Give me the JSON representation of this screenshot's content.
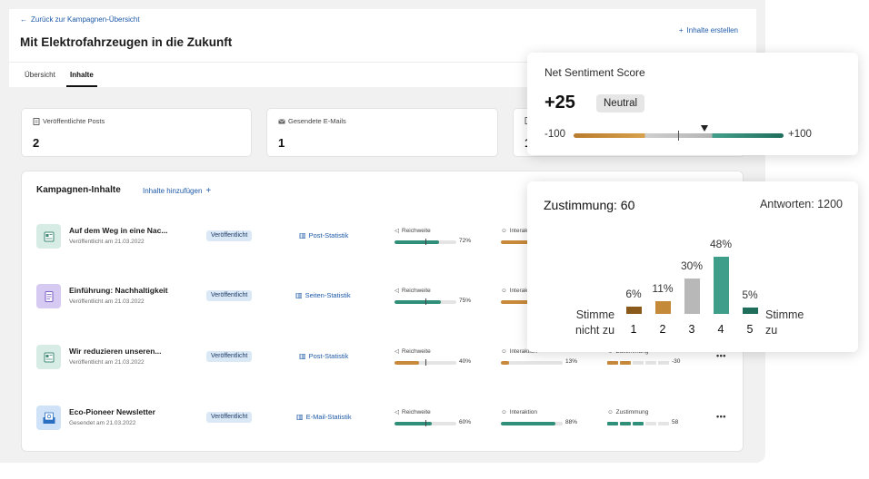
{
  "header": {
    "back_label": "Zurück zur Kampagnen-Übersicht",
    "title": "Mit Elektrofahrzeugen in die Zukunft",
    "create_label": "Inhalte erstellen"
  },
  "tabs": [
    {
      "label": "Übersicht",
      "active": false
    },
    {
      "label": "Inhalte",
      "active": true
    }
  ],
  "stats": [
    {
      "label": "Veröffentlichte Posts",
      "value": "2",
      "icon": "document-icon"
    },
    {
      "label": "Gesendete E-Mails",
      "value": "1",
      "icon": "mail-icon"
    },
    {
      "label": "",
      "value": "1",
      "icon": "document-icon"
    }
  ],
  "content": {
    "title": "Kampagnen-Inhalte",
    "add_label": "Inhalte hinzufügen",
    "rows": [
      {
        "title": "Auf dem Weg in eine Nac...",
        "date": "Veröffentlicht am 21.03.2022",
        "status": "Veröffentlicht",
        "link": "Post-Statistik",
        "icon": "post-icon",
        "icon_bg": "#d7ece5",
        "reach_label": "Reichweite",
        "reach": "72%",
        "reach_value": 0.72,
        "interaction_label": "Interaktion",
        "interaction": ""
      },
      {
        "title": "Einführung: Nachhaltigkeit",
        "date": "Veröffentlicht am 21.03.2022",
        "status": "Veröffentlicht",
        "link": "Seiten-Statistik",
        "icon": "page-icon",
        "icon_bg": "#d6c9f2",
        "reach_label": "Reichweite",
        "reach": "75%",
        "reach_value": 0.75,
        "interaction_label": "Interaktion",
        "interaction": ""
      },
      {
        "title": "Wir reduzieren unseren...",
        "date": "Veröffentlicht am 21.03.2022",
        "status": "Veröffentlicht",
        "link": "Post-Statistik",
        "icon": "post-icon",
        "icon_bg": "#d7ece5",
        "reach_label": "Reichweite",
        "reach": "40%",
        "reach_value": 0.4,
        "interaction_label": "Interaktion",
        "interaction": "13%",
        "interaction_value": 0.13,
        "approval_label": "Zustimmung",
        "approval": "-30",
        "approval_segments": 2
      },
      {
        "title": "Eco-Pioneer Newsletter",
        "date": "Gesendet am 21.03.2022",
        "status": "Veröffentlicht",
        "link": "E-Mail-Statistik",
        "icon": "newsletter-icon",
        "icon_bg": "#cfe2f7",
        "reach_label": "Reichweite",
        "reach": "60%",
        "reach_value": 0.6,
        "interaction_label": "Interaktion",
        "interaction": "88%",
        "interaction_value": 0.88,
        "approval_label": "Zustimmung",
        "approval": "58",
        "approval_segments": 3
      }
    ],
    "more_label": "•••"
  },
  "sentiment": {
    "title": "Net Sentiment Score",
    "value": "+25",
    "badge": "Neutral",
    "min": "-100",
    "max": "+100",
    "score": 25
  },
  "chart_data": {
    "type": "bar",
    "title": "Zustimmung: 60",
    "subtitle": "Antworten: 1200",
    "categories": [
      "1",
      "2",
      "3",
      "4",
      "5"
    ],
    "values": [
      6,
      11,
      30,
      48,
      5
    ],
    "labels": [
      "6%",
      "11%",
      "30%",
      "48%",
      "5%"
    ],
    "colors": [
      "#8a5a1c",
      "#c5893a",
      "#b8b8b8",
      "#3f9e89",
      "#1f6e5c"
    ],
    "left_label_1": "Stimme",
    "left_label_2": "nicht zu",
    "right_label_1": "Stimme",
    "right_label_2": "zu"
  },
  "colors": {
    "accent": "#1e5aa8",
    "teal": "#2f8f78",
    "orange": "#c8893a"
  }
}
